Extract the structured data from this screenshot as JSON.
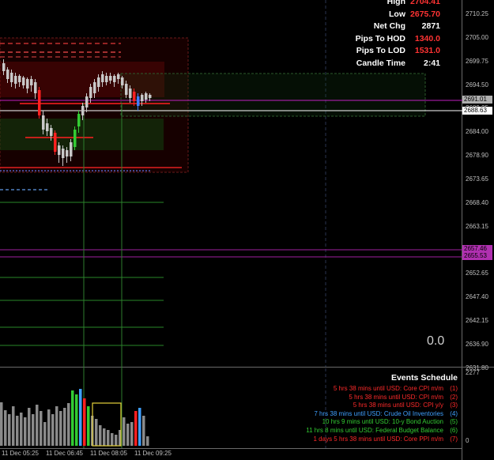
{
  "stats": [
    {
      "label": "High",
      "value": "2704.41",
      "color": "#ff3333"
    },
    {
      "label": "Low",
      "value": "2675.70",
      "color": "#ff3333"
    },
    {
      "label": "Net Chg",
      "value": "2871",
      "color": "#ffffff"
    },
    {
      "label": "Pips To HOD",
      "value": "1340.0",
      "color": "#ff3333"
    },
    {
      "label": "Pips To LOD",
      "value": "1531.0",
      "color": "#ff3333"
    },
    {
      "label": "Candle Time",
      "value": "2:41",
      "color": "#ffffff"
    }
  ],
  "price_ticks": [
    "2710.25",
    "2705.00",
    "2699.75",
    "2694.50",
    "2689.25",
    "2684.00",
    "2678.90",
    "2673.65",
    "2668.40",
    "2663.15",
    "2657.90",
    "2652.65",
    "2647.40",
    "2642.15",
    "2636.90",
    "2631.80"
  ],
  "price_tags": [
    {
      "text": "2691.01",
      "bg": "#b0b0b0"
    },
    {
      "text": "2688.63",
      "bg": "#ffffff"
    },
    {
      "text": "2657.46",
      "bg": "#b030b0"
    },
    {
      "text": "2655.53",
      "bg": "#b030b0"
    }
  ],
  "indicator_value": "0.0",
  "events": {
    "title": "Events Schedule",
    "items": [
      {
        "text": "5 hrs 38 mins until USD: Core CPI m/m",
        "num": "(1)",
        "color": "#ff2a2a"
      },
      {
        "text": "5 hrs 38 mins until USD: CPI m/m",
        "num": "(2)",
        "color": "#ff2a2a"
      },
      {
        "text": "5 hrs 38 mins until USD: CPI y/y",
        "num": "(3)",
        "color": "#ff2a2a"
      },
      {
        "text": "7 hrs 38 mins until USD: Crude Oil Inventories",
        "num": "(4)",
        "color": "#3fa0ff"
      },
      {
        "text": "10 hrs 9 mins until USD: 10-y Bond Auction",
        "num": "(5)",
        "color": "#33cc33"
      },
      {
        "text": "11 hrs 8 mins until USD: Federal Budget Balance",
        "num": "(6)",
        "color": "#33cc33"
      },
      {
        "text": "1 days 5 hrs 38 mins until USD: Core PPI m/m",
        "num": "(7)",
        "color": "#ff2a2a"
      }
    ]
  },
  "time_labels": [
    "11 Dec 05:25",
    "11 Dec 06:45",
    "11 Dec 08:05",
    "11 Dec 09:25"
  ],
  "volume_scale": {
    "max": "2277",
    "min": "0"
  }
}
